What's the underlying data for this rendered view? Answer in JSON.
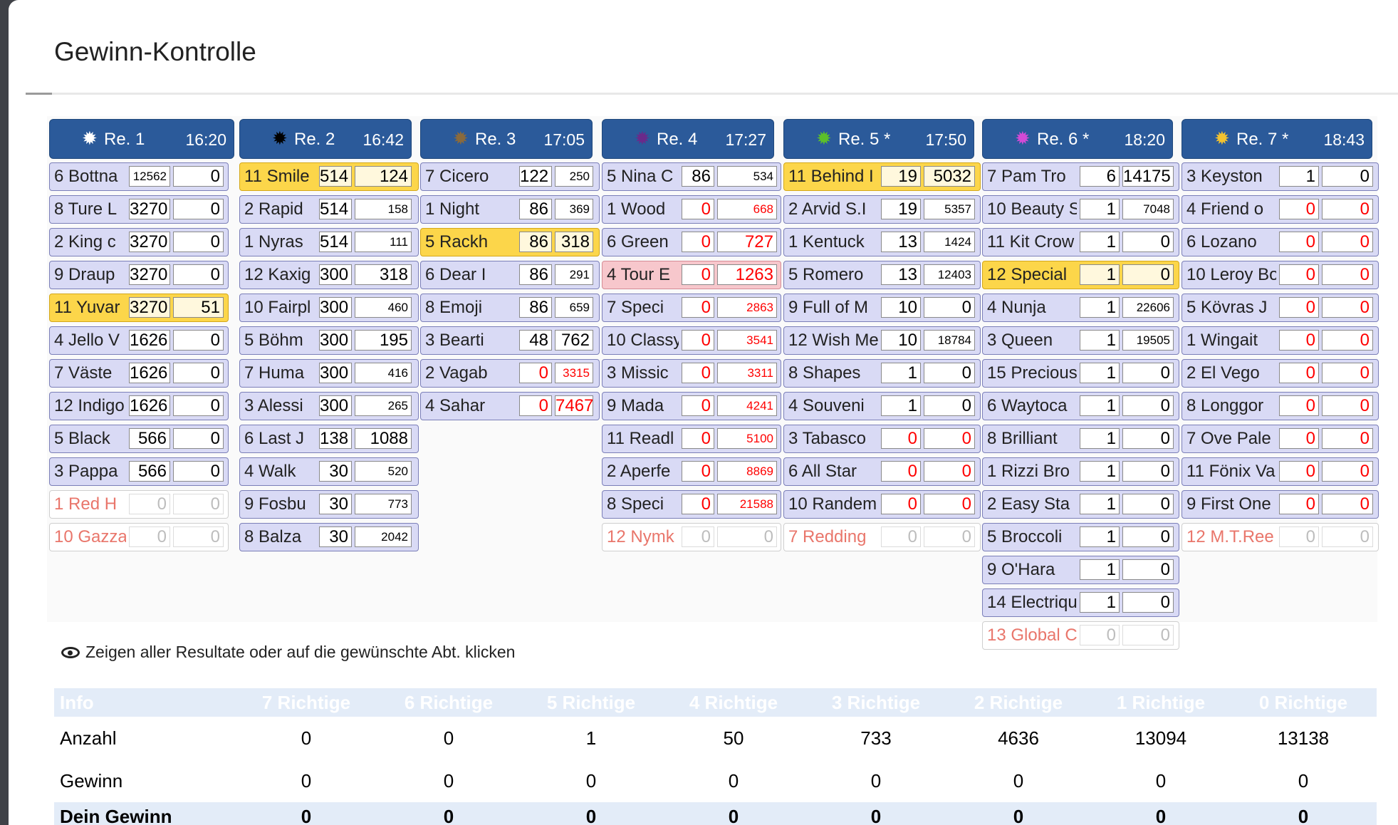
{
  "title": "Gewinn-Kontrolle",
  "hint": "Zeigen aller Resultate oder auf die gewünschte Abt. klicken",
  "races": [
    {
      "name": "Re. 1",
      "time": "16:20",
      "star_color": "#ffffff",
      "rows": [
        {
          "name": "6 Bottna",
          "v1": "12562",
          "v2": "0",
          "state": "normal"
        },
        {
          "name": "8 Ture L",
          "v1": "3270",
          "v2": "0",
          "state": "normal"
        },
        {
          "name": "2 King c",
          "v1": "3270",
          "v2": "0",
          "state": "normal"
        },
        {
          "name": "9 Draup",
          "v1": "3270",
          "v2": "0",
          "state": "normal"
        },
        {
          "name": "11 Yuvar",
          "v1": "3270",
          "v2": "51",
          "state": "win"
        },
        {
          "name": "4 Jello V",
          "v1": "1626",
          "v2": "0",
          "state": "normal"
        },
        {
          "name": "7 Väste",
          "v1": "1626",
          "v2": "0",
          "state": "normal"
        },
        {
          "name": "12 Indigo",
          "v1": "1626",
          "v2": "0",
          "state": "normal"
        },
        {
          "name": "5 Black",
          "v1": "566",
          "v2": "0",
          "state": "normal"
        },
        {
          "name": "3 Pappa",
          "v1": "566",
          "v2": "0",
          "state": "normal"
        },
        {
          "name": "1 Red H",
          "v1": "0",
          "v2": "0",
          "state": "scratched"
        },
        {
          "name": "10 Gazza",
          "v1": "0",
          "v2": "0",
          "state": "scratched"
        }
      ]
    },
    {
      "name": "Re. 2",
      "time": "16:42",
      "star_color": "#000000",
      "rows": [
        {
          "name": "11 Smile",
          "v1": "514",
          "v2": "124",
          "state": "win"
        },
        {
          "name": "2 Rapid",
          "v1": "514",
          "v2": "158",
          "state": "normal"
        },
        {
          "name": "1 Nyras",
          "v1": "514",
          "v2": "111",
          "state": "normal"
        },
        {
          "name": "12 Kaxig",
          "v1": "300",
          "v2": "318",
          "state": "normal"
        },
        {
          "name": "10 Fairpl",
          "v1": "300",
          "v2": "460",
          "state": "normal"
        },
        {
          "name": "5 Böhm",
          "v1": "300",
          "v2": "195",
          "state": "normal"
        },
        {
          "name": "7 Huma",
          "v1": "300",
          "v2": "416",
          "state": "normal"
        },
        {
          "name": "3 Alessi",
          "v1": "300",
          "v2": "265",
          "state": "normal"
        },
        {
          "name": "6 Last J",
          "v1": "138",
          "v2": "1088",
          "state": "normal"
        },
        {
          "name": "4 Walk",
          "v1": "30",
          "v2": "520",
          "state": "normal"
        },
        {
          "name": "9 Fosbu",
          "v1": "30",
          "v2": "773",
          "state": "normal"
        },
        {
          "name": "8 Balza",
          "v1": "30",
          "v2": "2042",
          "state": "normal"
        }
      ]
    },
    {
      "name": "Re. 3",
      "time": "17:05",
      "star_color": "#8a6a3c",
      "rows": [
        {
          "name": "7 Cicero",
          "v1": "122",
          "v2": "250",
          "state": "normal"
        },
        {
          "name": "1 Night",
          "v1": "86",
          "v2": "369",
          "state": "normal"
        },
        {
          "name": "5 Rackh",
          "v1": "86",
          "v2": "318",
          "state": "win"
        },
        {
          "name": "6 Dear I",
          "v1": "86",
          "v2": "291",
          "state": "normal"
        },
        {
          "name": "8 Emoji",
          "v1": "86",
          "v2": "659",
          "state": "normal"
        },
        {
          "name": "3 Bearti",
          "v1": "48",
          "v2": "762",
          "state": "normal"
        },
        {
          "name": "2 Vagab",
          "v1": "0",
          "v2": "3315",
          "state": "normal"
        },
        {
          "name": "4 Sahar",
          "v1": "0",
          "v2": "7467",
          "state": "normal"
        }
      ]
    },
    {
      "name": "Re. 4",
      "time": "17:27",
      "star_color": "#6a2a8a",
      "rows": [
        {
          "name": "5 Nina C",
          "v1": "86",
          "v2": "534",
          "state": "normal"
        },
        {
          "name": "1 Wood",
          "v1": "0",
          "v2": "668",
          "state": "normal"
        },
        {
          "name": "6 Green",
          "v1": "0",
          "v2": "727",
          "state": "normal"
        },
        {
          "name": "4 Tour E",
          "v1": "0",
          "v2": "1263",
          "state": "loss"
        },
        {
          "name": "7 Speci",
          "v1": "0",
          "v2": "2863",
          "state": "normal"
        },
        {
          "name": "10 Classy",
          "v1": "0",
          "v2": "3541",
          "state": "normal"
        },
        {
          "name": "3 Missic",
          "v1": "0",
          "v2": "3311",
          "state": "normal"
        },
        {
          "name": "9 Mada",
          "v1": "0",
          "v2": "4241",
          "state": "normal"
        },
        {
          "name": "11 Readl",
          "v1": "0",
          "v2": "5100",
          "state": "normal"
        },
        {
          "name": "2 Aperfe",
          "v1": "0",
          "v2": "8869",
          "state": "normal"
        },
        {
          "name": "8 Speci",
          "v1": "0",
          "v2": "21588",
          "state": "normal"
        },
        {
          "name": "12 Nymk",
          "v1": "0",
          "v2": "0",
          "state": "scratched"
        }
      ]
    },
    {
      "name": "Re. 5 *",
      "time": "17:50",
      "star_color": "#5cc02a",
      "rows": [
        {
          "name": "11 Behind I",
          "v1": "19",
          "v2": "5032",
          "state": "win"
        },
        {
          "name": "2 Arvid S.I",
          "v1": "19",
          "v2": "5357",
          "state": "normal"
        },
        {
          "name": "1 Kentuck",
          "v1": "13",
          "v2": "1424",
          "state": "normal"
        },
        {
          "name": "5 Romero",
          "v1": "13",
          "v2": "12403",
          "state": "normal"
        },
        {
          "name": "9 Full of M",
          "v1": "10",
          "v2": "0",
          "state": "normal"
        },
        {
          "name": "12 Wish Me",
          "v1": "10",
          "v2": "18784",
          "state": "normal"
        },
        {
          "name": "8 Shapes",
          "v1": "1",
          "v2": "0",
          "state": "normal"
        },
        {
          "name": "4 Souveni",
          "v1": "1",
          "v2": "0",
          "state": "normal"
        },
        {
          "name": "3 Tabasco",
          "v1": "0",
          "v2": "0",
          "state": "normal"
        },
        {
          "name": "6 All Star",
          "v1": "0",
          "v2": "0",
          "state": "normal"
        },
        {
          "name": "10 Randem",
          "v1": "0",
          "v2": "0",
          "state": "normal"
        },
        {
          "name": "7 Redding",
          "v1": "0",
          "v2": "0",
          "state": "scratched"
        }
      ]
    },
    {
      "name": "Re. 6 *",
      "time": "18:20",
      "star_color": "#d34ad6",
      "rows": [
        {
          "name": "7 Pam Tro",
          "v1": "6",
          "v2": "14175",
          "state": "normal"
        },
        {
          "name": "10 Beauty S",
          "v1": "1",
          "v2": "7048",
          "state": "normal"
        },
        {
          "name": "11 Kit Crow",
          "v1": "1",
          "v2": "0",
          "state": "normal"
        },
        {
          "name": "12 Special",
          "v1": "1",
          "v2": "0",
          "state": "win"
        },
        {
          "name": "4 Nunja",
          "v1": "1",
          "v2": "22606",
          "state": "normal"
        },
        {
          "name": "3 Queen",
          "v1": "1",
          "v2": "19505",
          "state": "normal"
        },
        {
          "name": "15 Precious",
          "v1": "1",
          "v2": "0",
          "state": "normal"
        },
        {
          "name": "6 Waytoca",
          "v1": "1",
          "v2": "0",
          "state": "normal"
        },
        {
          "name": "8 Brilliant",
          "v1": "1",
          "v2": "0",
          "state": "normal"
        },
        {
          "name": "1 Rizzi Bro",
          "v1": "1",
          "v2": "0",
          "state": "normal"
        },
        {
          "name": "2 Easy Sta",
          "v1": "1",
          "v2": "0",
          "state": "normal"
        },
        {
          "name": "5 Broccoli",
          "v1": "1",
          "v2": "0",
          "state": "normal"
        },
        {
          "name": "9 O'Hara",
          "v1": "1",
          "v2": "0",
          "state": "normal"
        },
        {
          "name": "14 Electriqu",
          "v1": "1",
          "v2": "0",
          "state": "normal"
        },
        {
          "name": "13 Global C",
          "v1": "0",
          "v2": "0",
          "state": "scratched"
        }
      ]
    },
    {
      "name": "Re. 7 *",
      "time": "18:43",
      "star_color": "#f2c230",
      "rows": [
        {
          "name": "3 Keyston",
          "v1": "1",
          "v2": "0",
          "state": "normal"
        },
        {
          "name": "4 Friend o",
          "v1": "0",
          "v2": "0",
          "state": "normal"
        },
        {
          "name": "6 Lozano",
          "v1": "0",
          "v2": "0",
          "state": "normal"
        },
        {
          "name": "10 Leroy Bo",
          "v1": "0",
          "v2": "0",
          "state": "normal"
        },
        {
          "name": "5 Kövras J",
          "v1": "0",
          "v2": "0",
          "state": "normal"
        },
        {
          "name": "1 Wingait",
          "v1": "0",
          "v2": "0",
          "state": "normal"
        },
        {
          "name": "2 El Vego",
          "v1": "0",
          "v2": "0",
          "state": "normal"
        },
        {
          "name": "8 Longgor",
          "v1": "0",
          "v2": "0",
          "state": "normal"
        },
        {
          "name": "7 Ove Pale",
          "v1": "0",
          "v2": "0",
          "state": "normal"
        },
        {
          "name": "11 Fönix Va",
          "v1": "0",
          "v2": "0",
          "state": "normal"
        },
        {
          "name": "9 First One",
          "v1": "0",
          "v2": "0",
          "state": "normal"
        },
        {
          "name": "12 M.T.Ree",
          "v1": "0",
          "v2": "0",
          "state": "scratched"
        }
      ]
    }
  ],
  "summary": {
    "headers": [
      "Info",
      "7 Richtige",
      "6 Richtige",
      "5 Richtige",
      "4 Richtige",
      "3 Richtige",
      "2 Richtige",
      "1 Richtige",
      "0 Richtige"
    ],
    "rows": [
      {
        "label": "Anzahl",
        "values": [
          "0",
          "0",
          "1",
          "50",
          "733",
          "4636",
          "13094",
          "13138"
        ]
      },
      {
        "label": "Gewinn",
        "values": [
          "0",
          "0",
          "0",
          "0",
          "0",
          "0",
          "0",
          "0"
        ]
      },
      {
        "label": "Dein Gewinn",
        "values": [
          "0",
          "0",
          "0",
          "0",
          "0",
          "0",
          "0",
          "0"
        ]
      }
    ]
  }
}
